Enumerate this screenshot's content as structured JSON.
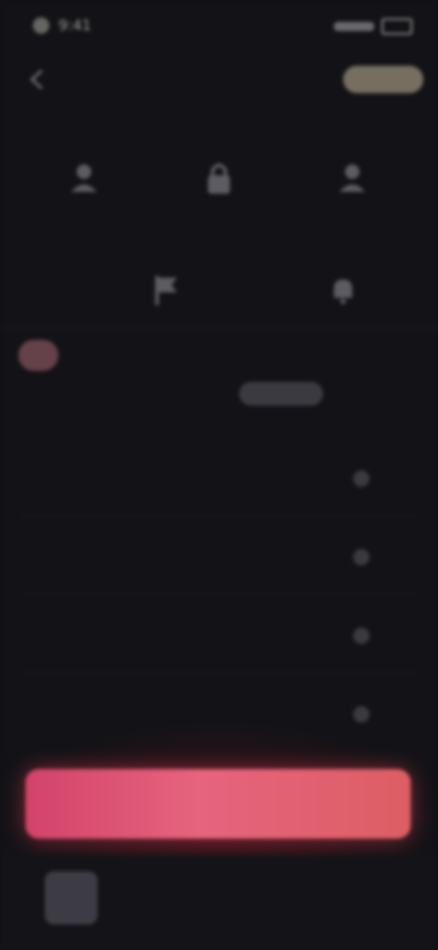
{
  "status_bar": {
    "time": "9:41"
  },
  "header": {
    "title": "",
    "action_label": ""
  },
  "options": [
    {
      "label": "",
      "icon": "person-icon"
    },
    {
      "label": "",
      "icon": "lock-icon"
    },
    {
      "label": "",
      "icon": "user-plus-icon"
    },
    {
      "label": "",
      "icon": "flag-icon"
    },
    {
      "label": "",
      "icon": "bell-icon"
    }
  ],
  "section": {
    "label": ""
  },
  "profile": {
    "name": "",
    "button_label": ""
  },
  "settings": [
    {
      "label": "",
      "icon": "chevron-icon"
    },
    {
      "label": "",
      "icon": "chevron-icon"
    },
    {
      "label": "",
      "icon": "chevron-icon"
    },
    {
      "label": "",
      "icon": "chevron-icon"
    }
  ],
  "cta": {
    "label": ""
  },
  "tabs": [
    {
      "label": ""
    },
    {
      "label": ""
    },
    {
      "label": ""
    },
    {
      "label": ""
    },
    {
      "label": ""
    }
  ],
  "colors": {
    "background": "#131317",
    "cta_gradient_start": "#d2436a",
    "cta_gradient_end": "#dd5e64",
    "header_action": "#c9b99a"
  }
}
